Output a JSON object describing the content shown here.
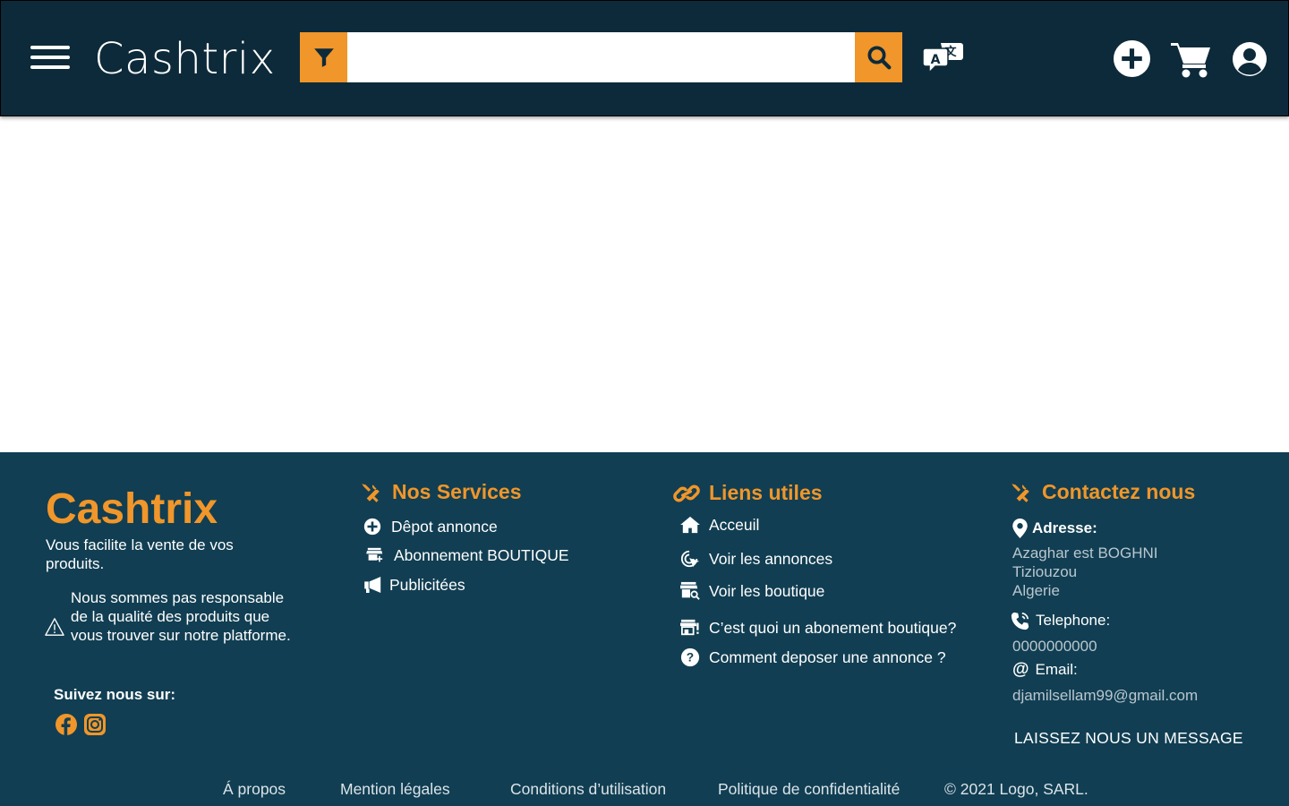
{
  "header": {
    "brand": "Cashtrix",
    "search_placeholder": "",
    "search_value": ""
  },
  "footer": {
    "brand": "Cashtrix",
    "tagline": "Vous facilite la vente de vos produits.",
    "warning": "Nous sommes pas responsable de la qualité des produits que vous trouver sur notre platforme.",
    "follow_label": "Suivez nous sur:",
    "services": {
      "title": "Nos Services",
      "items": [
        "Dêpot annonce",
        "Abonnement BOUTIQUE",
        "Publicitées"
      ]
    },
    "links": {
      "title": "Liens utiles",
      "items": [
        "Acceuil",
        "Voir les annonces",
        "Voir les boutique",
        "C’est quoi un abonement boutique?",
        "Comment deposer une annonce ?"
      ]
    },
    "contact": {
      "title": "Contactez nous",
      "address_label": "Adresse:",
      "address_lines": [
        "Azaghar est BOGHNI",
        "Tiziouzou",
        "Algerie"
      ],
      "phone_label": "Telephone:",
      "phone": "0000000000",
      "email_label": "Email:",
      "email": "djamilsellam99@gmail.com",
      "cta": "LAISSEZ NOUS UN MESSAGE"
    },
    "bottom": {
      "links": [
        "Á propos",
        "Mention légales",
        "Conditions d’utilisation",
        "Politique de confidentialité"
      ],
      "copyright": "© 2021 Logo, SARL."
    }
  },
  "colors": {
    "header_bg": "#0d2a3a",
    "footer_bg": "#113e52",
    "accent": "#f0962a"
  },
  "icons": [
    "menu-icon",
    "filter-icon",
    "search-icon",
    "translate-icon",
    "add-circle-icon",
    "cart-icon",
    "user-account-icon",
    "tools-icon",
    "link-icon",
    "warning-icon",
    "facebook-icon",
    "instagram-icon",
    "location-pin-icon",
    "phone-icon",
    "at-icon"
  ]
}
